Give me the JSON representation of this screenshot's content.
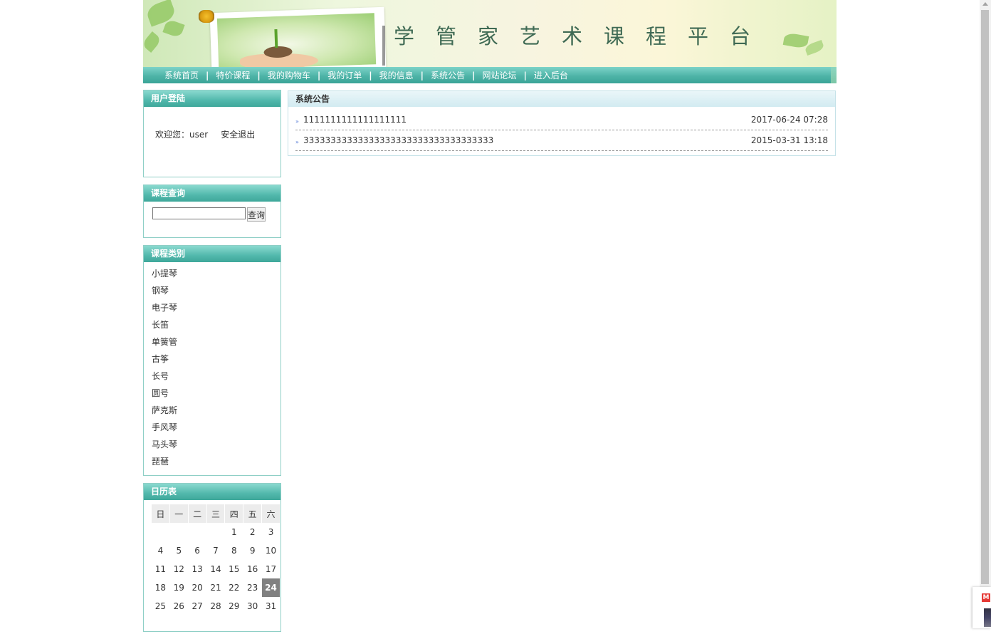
{
  "banner": {
    "title": "学管家艺术课程平台"
  },
  "nav": {
    "items": [
      {
        "label": "系统首页"
      },
      {
        "label": "特价课程"
      },
      {
        "label": "我的购物车"
      },
      {
        "label": "我的订单"
      },
      {
        "label": "我的信息"
      },
      {
        "label": "系统公告"
      },
      {
        "label": "网站论坛"
      },
      {
        "label": "进入后台"
      }
    ],
    "separator": "|"
  },
  "login": {
    "header": "用户登陆",
    "welcome": "欢迎您：user",
    "logout": "安全退出"
  },
  "search": {
    "header": "课程查询",
    "value": "",
    "button": "查询"
  },
  "categories": {
    "header": "课程类别",
    "items": [
      "小提琴",
      "钢琴",
      "电子琴",
      "长笛",
      "单簧管",
      "古筝",
      "长号",
      "圆号",
      "萨克斯",
      "手风琴",
      "马头琴",
      "琵琶"
    ]
  },
  "calendar": {
    "header": "日历表",
    "weekdays": [
      "日",
      "一",
      "二",
      "三",
      "四",
      "五",
      "六"
    ],
    "weeks": [
      [
        "",
        "",
        "",
        "",
        "1",
        "2",
        "3"
      ],
      [
        "4",
        "5",
        "6",
        "7",
        "8",
        "9",
        "10"
      ],
      [
        "11",
        "12",
        "13",
        "14",
        "15",
        "16",
        "17"
      ],
      [
        "18",
        "19",
        "20",
        "21",
        "22",
        "23",
        "24"
      ],
      [
        "25",
        "26",
        "27",
        "28",
        "29",
        "30",
        "31"
      ]
    ],
    "today": "24"
  },
  "notices": {
    "header": "系统公告",
    "items": [
      {
        "title": "1111111111111111111",
        "date": "2017-06-24 07:28"
      },
      {
        "title": "33333333333333333333333333333333333",
        "date": "2015-03-31 13:18"
      }
    ]
  },
  "icons": {
    "bullet": "double-arrow-icon"
  }
}
